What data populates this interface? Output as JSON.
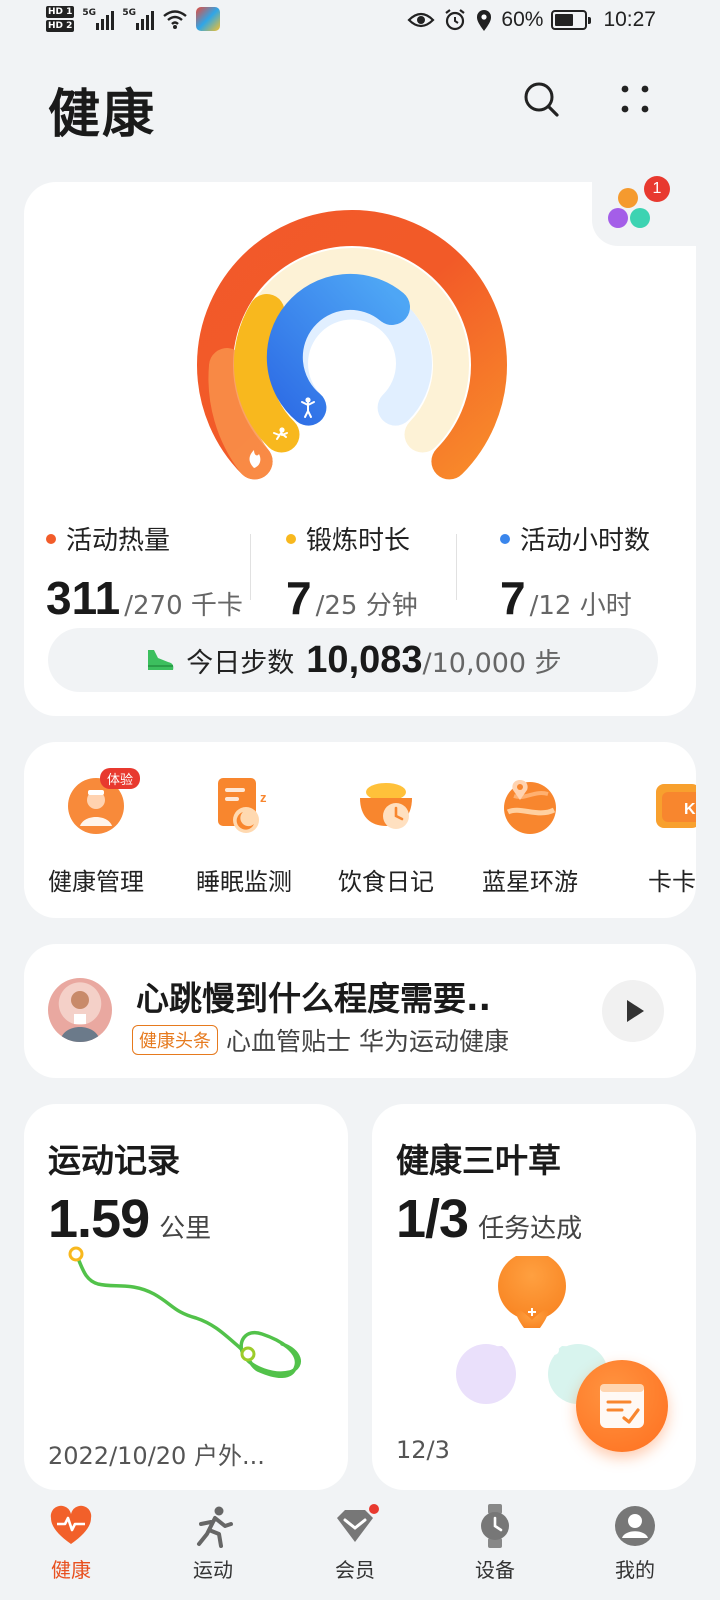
{
  "status_bar": {
    "hd1": "HD 1",
    "hd2": "HD 2",
    "sig1": "5G",
    "sig2": "5G",
    "battery": "60%",
    "time": "10:27"
  },
  "header": {
    "title": "健康",
    "search_icon": "search-icon",
    "more_icon": "more-grid-icon"
  },
  "rings_card": {
    "badge_count": "1",
    "ring_progress": {
      "calories": 1.0,
      "exercise": 0.28,
      "active_hours": 0.58
    },
    "colors": {
      "calories": "#f25c2a",
      "exercise": "#f8b81e",
      "active_hours": "#3a86ec"
    },
    "stats": [
      {
        "label": "活动热量",
        "value": "311",
        "goal": "/270 千卡",
        "color": "#f25c2a"
      },
      {
        "label": "锻炼时长",
        "value": "7",
        "goal": "/25 分钟",
        "color": "#f8b81e"
      },
      {
        "label": "活动小时数",
        "value": "7",
        "goal": "/12 小时",
        "color": "#3a86ec"
      }
    ],
    "steps": {
      "label": "今日步数",
      "value": "10,083",
      "goal": "/10,000 步"
    }
  },
  "shortcuts": [
    {
      "label": "健康管理",
      "badge": "体验"
    },
    {
      "label": "睡眠监测"
    },
    {
      "label": "饮食日记"
    },
    {
      "label": "蓝星环游"
    },
    {
      "label": "卡卡"
    }
  ],
  "news": {
    "title": "心跳慢到什么程度需要..",
    "tag": "健康头条",
    "source": "心血管贴士 华为运动健康"
  },
  "sport_record": {
    "title": "运动记录",
    "value": "1.59",
    "unit": "公里",
    "footer": "2022/10/20 户外..."
  },
  "clover": {
    "title": "健康三叶草",
    "value": "1/3",
    "unit": "任务达成",
    "footer": "12/3"
  },
  "bottom_nav": [
    {
      "label": "健康",
      "active": true
    },
    {
      "label": "运动"
    },
    {
      "label": "会员"
    },
    {
      "label": "设备"
    },
    {
      "label": "我的"
    }
  ]
}
